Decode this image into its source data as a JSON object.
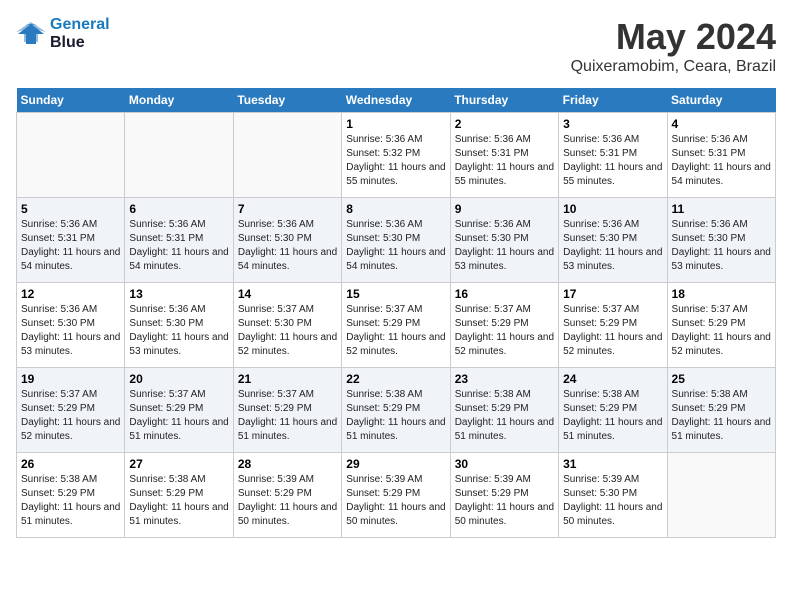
{
  "header": {
    "logo_line1": "General",
    "logo_line2": "Blue",
    "month": "May 2024",
    "location": "Quixeramobim, Ceara, Brazil"
  },
  "weekdays": [
    "Sunday",
    "Monday",
    "Tuesday",
    "Wednesday",
    "Thursday",
    "Friday",
    "Saturday"
  ],
  "weeks": [
    [
      {
        "day": "",
        "sunrise": "",
        "sunset": "",
        "daylight": ""
      },
      {
        "day": "",
        "sunrise": "",
        "sunset": "",
        "daylight": ""
      },
      {
        "day": "",
        "sunrise": "",
        "sunset": "",
        "daylight": ""
      },
      {
        "day": "1",
        "sunrise": "Sunrise: 5:36 AM",
        "sunset": "Sunset: 5:32 PM",
        "daylight": "Daylight: 11 hours and 55 minutes."
      },
      {
        "day": "2",
        "sunrise": "Sunrise: 5:36 AM",
        "sunset": "Sunset: 5:31 PM",
        "daylight": "Daylight: 11 hours and 55 minutes."
      },
      {
        "day": "3",
        "sunrise": "Sunrise: 5:36 AM",
        "sunset": "Sunset: 5:31 PM",
        "daylight": "Daylight: 11 hours and 55 minutes."
      },
      {
        "day": "4",
        "sunrise": "Sunrise: 5:36 AM",
        "sunset": "Sunset: 5:31 PM",
        "daylight": "Daylight: 11 hours and 54 minutes."
      }
    ],
    [
      {
        "day": "5",
        "sunrise": "Sunrise: 5:36 AM",
        "sunset": "Sunset: 5:31 PM",
        "daylight": "Daylight: 11 hours and 54 minutes."
      },
      {
        "day": "6",
        "sunrise": "Sunrise: 5:36 AM",
        "sunset": "Sunset: 5:31 PM",
        "daylight": "Daylight: 11 hours and 54 minutes."
      },
      {
        "day": "7",
        "sunrise": "Sunrise: 5:36 AM",
        "sunset": "Sunset: 5:30 PM",
        "daylight": "Daylight: 11 hours and 54 minutes."
      },
      {
        "day": "8",
        "sunrise": "Sunrise: 5:36 AM",
        "sunset": "Sunset: 5:30 PM",
        "daylight": "Daylight: 11 hours and 54 minutes."
      },
      {
        "day": "9",
        "sunrise": "Sunrise: 5:36 AM",
        "sunset": "Sunset: 5:30 PM",
        "daylight": "Daylight: 11 hours and 53 minutes."
      },
      {
        "day": "10",
        "sunrise": "Sunrise: 5:36 AM",
        "sunset": "Sunset: 5:30 PM",
        "daylight": "Daylight: 11 hours and 53 minutes."
      },
      {
        "day": "11",
        "sunrise": "Sunrise: 5:36 AM",
        "sunset": "Sunset: 5:30 PM",
        "daylight": "Daylight: 11 hours and 53 minutes."
      }
    ],
    [
      {
        "day": "12",
        "sunrise": "Sunrise: 5:36 AM",
        "sunset": "Sunset: 5:30 PM",
        "daylight": "Daylight: 11 hours and 53 minutes."
      },
      {
        "day": "13",
        "sunrise": "Sunrise: 5:36 AM",
        "sunset": "Sunset: 5:30 PM",
        "daylight": "Daylight: 11 hours and 53 minutes."
      },
      {
        "day": "14",
        "sunrise": "Sunrise: 5:37 AM",
        "sunset": "Sunset: 5:30 PM",
        "daylight": "Daylight: 11 hours and 52 minutes."
      },
      {
        "day": "15",
        "sunrise": "Sunrise: 5:37 AM",
        "sunset": "Sunset: 5:29 PM",
        "daylight": "Daylight: 11 hours and 52 minutes."
      },
      {
        "day": "16",
        "sunrise": "Sunrise: 5:37 AM",
        "sunset": "Sunset: 5:29 PM",
        "daylight": "Daylight: 11 hours and 52 minutes."
      },
      {
        "day": "17",
        "sunrise": "Sunrise: 5:37 AM",
        "sunset": "Sunset: 5:29 PM",
        "daylight": "Daylight: 11 hours and 52 minutes."
      },
      {
        "day": "18",
        "sunrise": "Sunrise: 5:37 AM",
        "sunset": "Sunset: 5:29 PM",
        "daylight": "Daylight: 11 hours and 52 minutes."
      }
    ],
    [
      {
        "day": "19",
        "sunrise": "Sunrise: 5:37 AM",
        "sunset": "Sunset: 5:29 PM",
        "daylight": "Daylight: 11 hours and 52 minutes."
      },
      {
        "day": "20",
        "sunrise": "Sunrise: 5:37 AM",
        "sunset": "Sunset: 5:29 PM",
        "daylight": "Daylight: 11 hours and 51 minutes."
      },
      {
        "day": "21",
        "sunrise": "Sunrise: 5:37 AM",
        "sunset": "Sunset: 5:29 PM",
        "daylight": "Daylight: 11 hours and 51 minutes."
      },
      {
        "day": "22",
        "sunrise": "Sunrise: 5:38 AM",
        "sunset": "Sunset: 5:29 PM",
        "daylight": "Daylight: 11 hours and 51 minutes."
      },
      {
        "day": "23",
        "sunrise": "Sunrise: 5:38 AM",
        "sunset": "Sunset: 5:29 PM",
        "daylight": "Daylight: 11 hours and 51 minutes."
      },
      {
        "day": "24",
        "sunrise": "Sunrise: 5:38 AM",
        "sunset": "Sunset: 5:29 PM",
        "daylight": "Daylight: 11 hours and 51 minutes."
      },
      {
        "day": "25",
        "sunrise": "Sunrise: 5:38 AM",
        "sunset": "Sunset: 5:29 PM",
        "daylight": "Daylight: 11 hours and 51 minutes."
      }
    ],
    [
      {
        "day": "26",
        "sunrise": "Sunrise: 5:38 AM",
        "sunset": "Sunset: 5:29 PM",
        "daylight": "Daylight: 11 hours and 51 minutes."
      },
      {
        "day": "27",
        "sunrise": "Sunrise: 5:38 AM",
        "sunset": "Sunset: 5:29 PM",
        "daylight": "Daylight: 11 hours and 51 minutes."
      },
      {
        "day": "28",
        "sunrise": "Sunrise: 5:39 AM",
        "sunset": "Sunset: 5:29 PM",
        "daylight": "Daylight: 11 hours and 50 minutes."
      },
      {
        "day": "29",
        "sunrise": "Sunrise: 5:39 AM",
        "sunset": "Sunset: 5:29 PM",
        "daylight": "Daylight: 11 hours and 50 minutes."
      },
      {
        "day": "30",
        "sunrise": "Sunrise: 5:39 AM",
        "sunset": "Sunset: 5:29 PM",
        "daylight": "Daylight: 11 hours and 50 minutes."
      },
      {
        "day": "31",
        "sunrise": "Sunrise: 5:39 AM",
        "sunset": "Sunset: 5:30 PM",
        "daylight": "Daylight: 11 hours and 50 minutes."
      },
      {
        "day": "",
        "sunrise": "",
        "sunset": "",
        "daylight": ""
      }
    ]
  ]
}
